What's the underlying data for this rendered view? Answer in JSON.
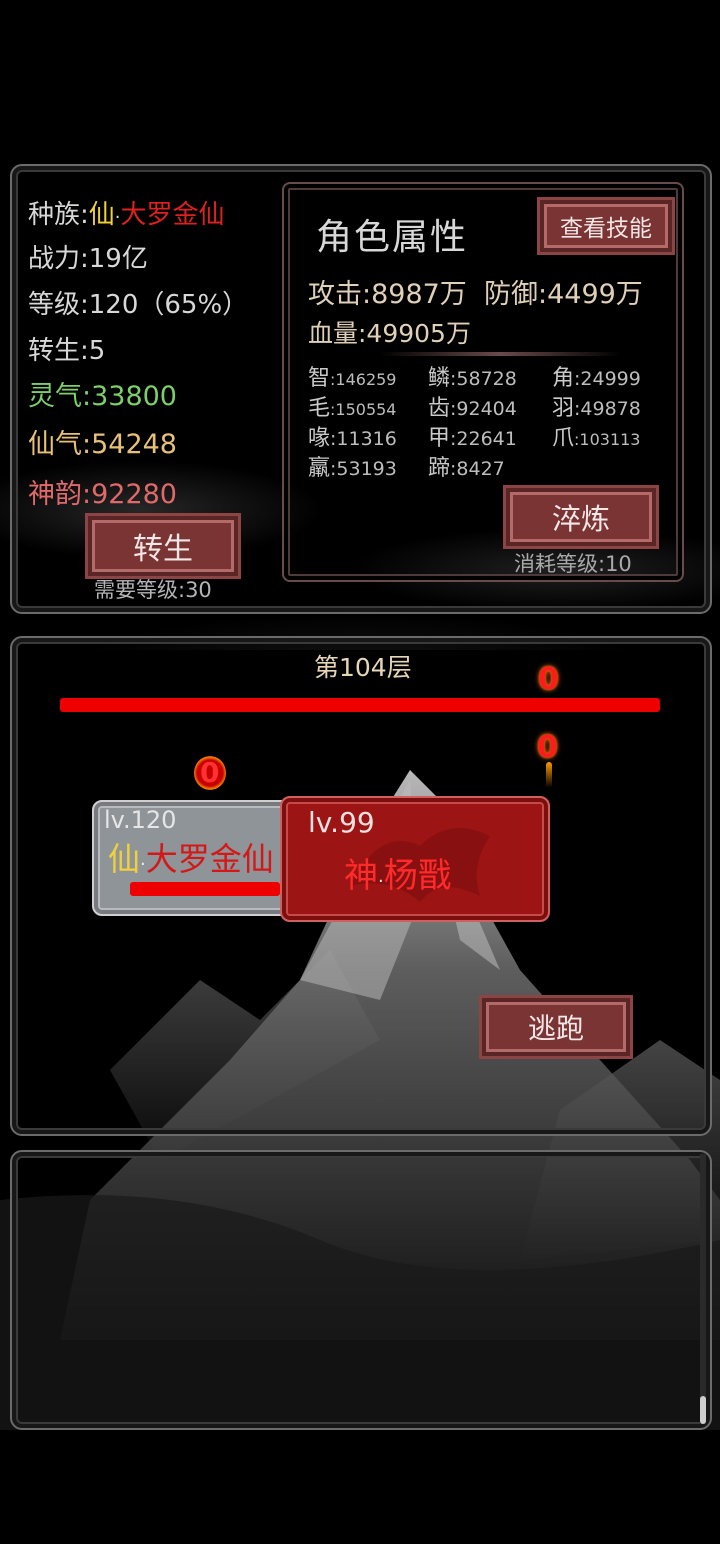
{
  "player": {
    "race_label": "种族:",
    "race_kind": "仙",
    "race_dot": "·",
    "race_rank": "大罗金仙",
    "power": "战力:19亿",
    "level": "等级:120（65%）",
    "rebirth": "转生:5",
    "lingqi": "灵气:33800",
    "xianqi": "仙气:54248",
    "shenyun": "神韵:92280",
    "rebirth_button": "转生",
    "rebirth_req": "需要等级:30"
  },
  "attributes": {
    "title": "角色属性",
    "view_skills_button": "查看技能",
    "attack": "攻击:8987万",
    "defense": "防御:4499万",
    "hp": "血量:49905万",
    "stats": [
      {
        "name": "智",
        "value": ":146259",
        "small": true
      },
      {
        "name": "鳞",
        "value": ":58728",
        "small": false
      },
      {
        "name": "角",
        "value": ":24999",
        "small": false
      },
      {
        "name": "毛",
        "value": ":150554",
        "small": true
      },
      {
        "name": "齿",
        "value": ":92404",
        "small": false
      },
      {
        "name": "羽",
        "value": ":49878",
        "small": false
      },
      {
        "name": "喙",
        "value": ":11316",
        "small": false
      },
      {
        "name": "甲",
        "value": ":22641",
        "small": false
      },
      {
        "name": "爪",
        "value": ":103113",
        "small": true
      },
      {
        "name": "羸",
        "value": ":53193",
        "small": false
      },
      {
        "name": "蹄",
        "value": ":8427",
        "small": false
      }
    ],
    "refine_button": "淬炼",
    "refine_cost": "消耗等级:10"
  },
  "battle": {
    "floor": "第104层",
    "enemy_hp_fraction": 1.0,
    "damage_top": "0",
    "damage_enemy": "0",
    "damage_player": "0",
    "player_card": {
      "level": "lv.120",
      "kind": "仙",
      "dot": "·",
      "name": "大罗金仙"
    },
    "player_hp_fraction": 1.0,
    "enemy_card": {
      "level": "lv.99",
      "kind": "神",
      "dot": "·",
      "name": "杨戬"
    },
    "flee_button": "逃跑"
  },
  "colors": {
    "race_kind": "#f1d13a",
    "race_rank": "#e02020",
    "lingqi": "#7ccf6a",
    "xianqi": "#e8c07a",
    "shenyun": "#e06a6a",
    "button": "#7a3434",
    "hp_bar": "#e00000"
  }
}
